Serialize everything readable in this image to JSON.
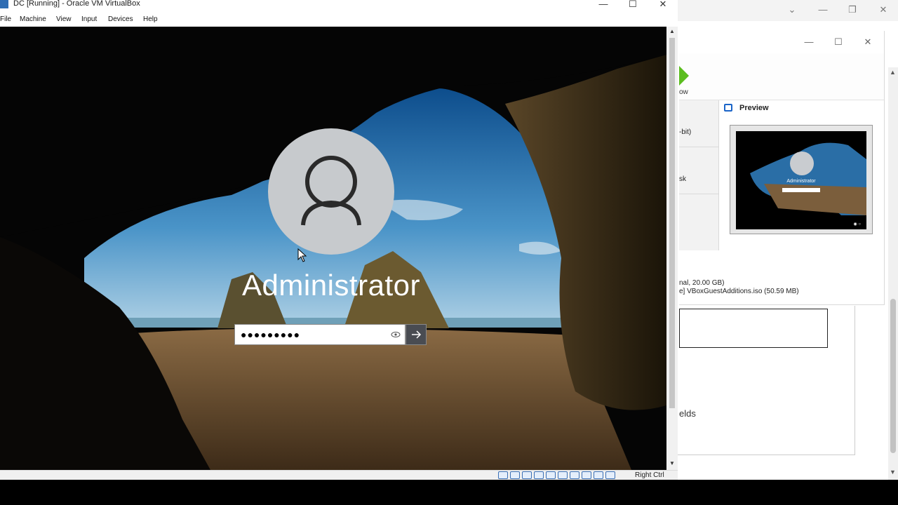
{
  "vm_window": {
    "title": "DC [Running] - Oracle VM VirtualBox",
    "controls": {
      "minimize": "—",
      "maximize": "☐",
      "close": "✕"
    },
    "menu": [
      "File",
      "Machine",
      "View",
      "Input",
      "Devices",
      "Help"
    ],
    "status_host_key": "Right Ctrl"
  },
  "login": {
    "username": "Administrator",
    "password_masked": "●●●●●●●●●",
    "reveal_icon": "eye-icon",
    "submit_icon": "arrow-right-icon"
  },
  "background_manager": {
    "toolbar_label": "ow",
    "left_rows": [
      "-bit)",
      "sk"
    ],
    "preview_title": "Preview",
    "preview_username": "Administrator",
    "storage_lines": [
      "nal, 20.00 GB)",
      "e] VBoxGuestAdditions.iso (50.59 MB)"
    ],
    "fields_label": "elds"
  },
  "colors": {
    "accent_green": "#5bbd1f",
    "vbox_blue": "#2f6db3",
    "login_button": "#494c52"
  }
}
